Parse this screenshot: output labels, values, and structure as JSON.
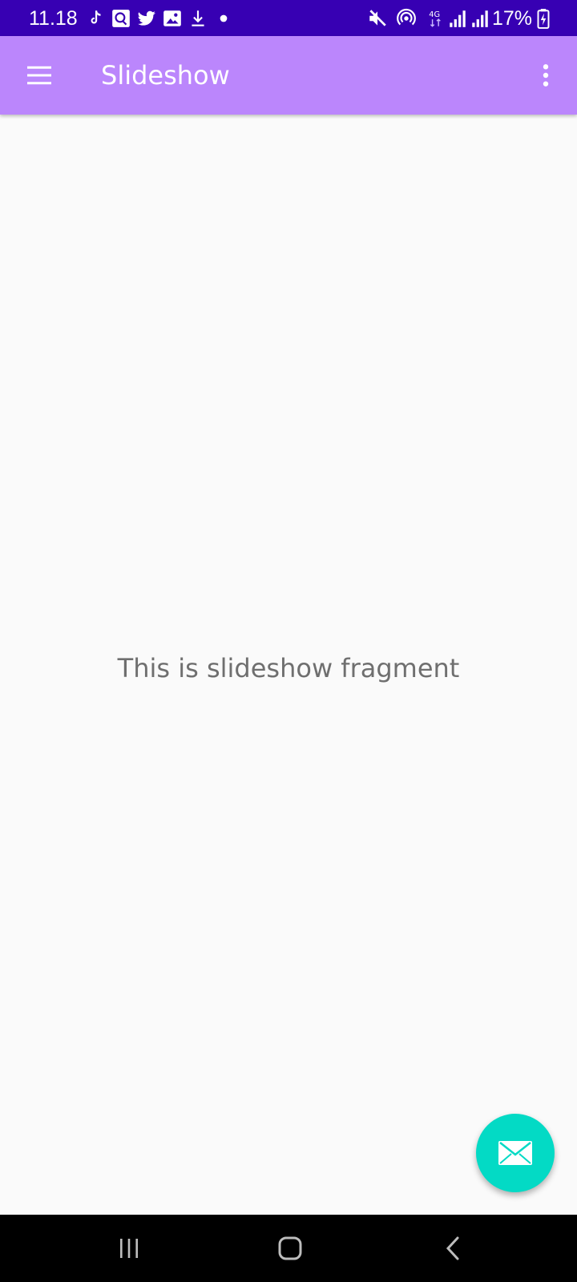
{
  "status_bar": {
    "time": "11.18",
    "battery": "17%",
    "icons": [
      "tiktok-icon",
      "messenger-icon",
      "twitter-icon",
      "gallery-icon",
      "download-icon",
      "dot-icon",
      "mute-icon",
      "hotspot-icon",
      "4g-icon",
      "signal-icon",
      "signal-icon",
      "battery-charging-icon"
    ]
  },
  "app_bar": {
    "title": "Slideshow",
    "background": "#bb86fc"
  },
  "content": {
    "message": "This is slideshow fragment"
  },
  "fab": {
    "icon": "email-icon",
    "color": "#03dac5"
  },
  "navigation_bar": {
    "buttons": [
      "recents-icon",
      "home-icon",
      "back-icon"
    ]
  }
}
